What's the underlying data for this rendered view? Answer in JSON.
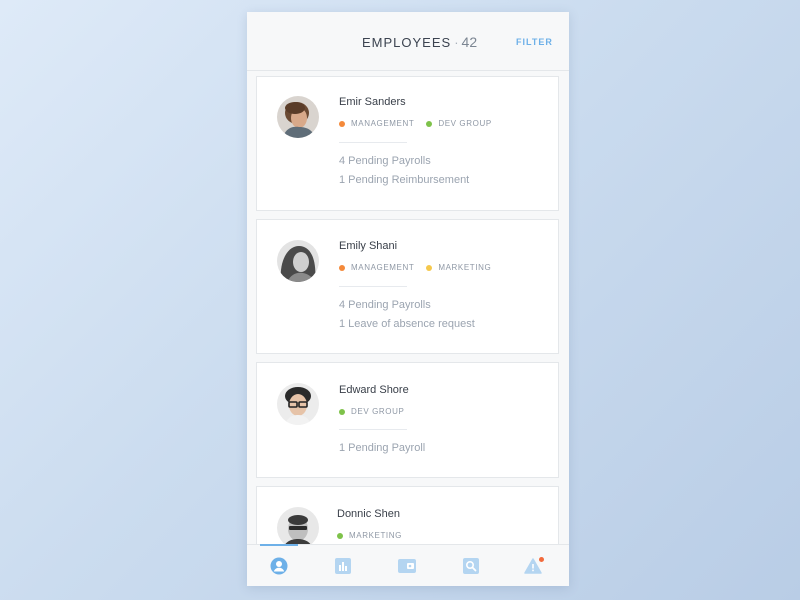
{
  "header": {
    "title": "EMPLOYEES",
    "separator": "·",
    "count": "42",
    "filter_label": "FILTER"
  },
  "colors": {
    "accent": "#6db0e8",
    "management": "#f4893a",
    "dev_group": "#7ec24a",
    "marketing": "#f5c84c",
    "alert_badge": "#f26a3c"
  },
  "employees": [
    {
      "name": "Emir Sanders",
      "tags": [
        {
          "label": "MANAGEMENT",
          "color": "#f4893a"
        },
        {
          "label": "DEV GROUP",
          "color": "#7ec24a"
        }
      ],
      "pending": [
        "4 Pending Payrolls",
        "1 Pending Reimbursement"
      ]
    },
    {
      "name": "Emily Shani",
      "tags": [
        {
          "label": "MANAGEMENT",
          "color": "#f4893a"
        },
        {
          "label": "MARKETING",
          "color": "#f5c84c"
        }
      ],
      "pending": [
        "4 Pending Payrolls",
        "1 Leave of absence request"
      ]
    },
    {
      "name": "Edward Shore",
      "tags": [
        {
          "label": "DEV GROUP",
          "color": "#7ec24a"
        }
      ],
      "pending": [
        "1 Pending Payroll"
      ]
    },
    {
      "name": "Donnic Shen",
      "tags": [
        {
          "label": "MARKETING",
          "color": "#7ec24a"
        }
      ],
      "pending": []
    }
  ],
  "tabbar": {
    "tabs": [
      {
        "icon": "user-circle-icon",
        "active": true
      },
      {
        "icon": "bar-chart-icon",
        "active": false
      },
      {
        "icon": "wallet-icon",
        "active": false
      },
      {
        "icon": "search-icon",
        "active": false
      },
      {
        "icon": "alert-icon",
        "active": false,
        "badge": true
      }
    ]
  }
}
